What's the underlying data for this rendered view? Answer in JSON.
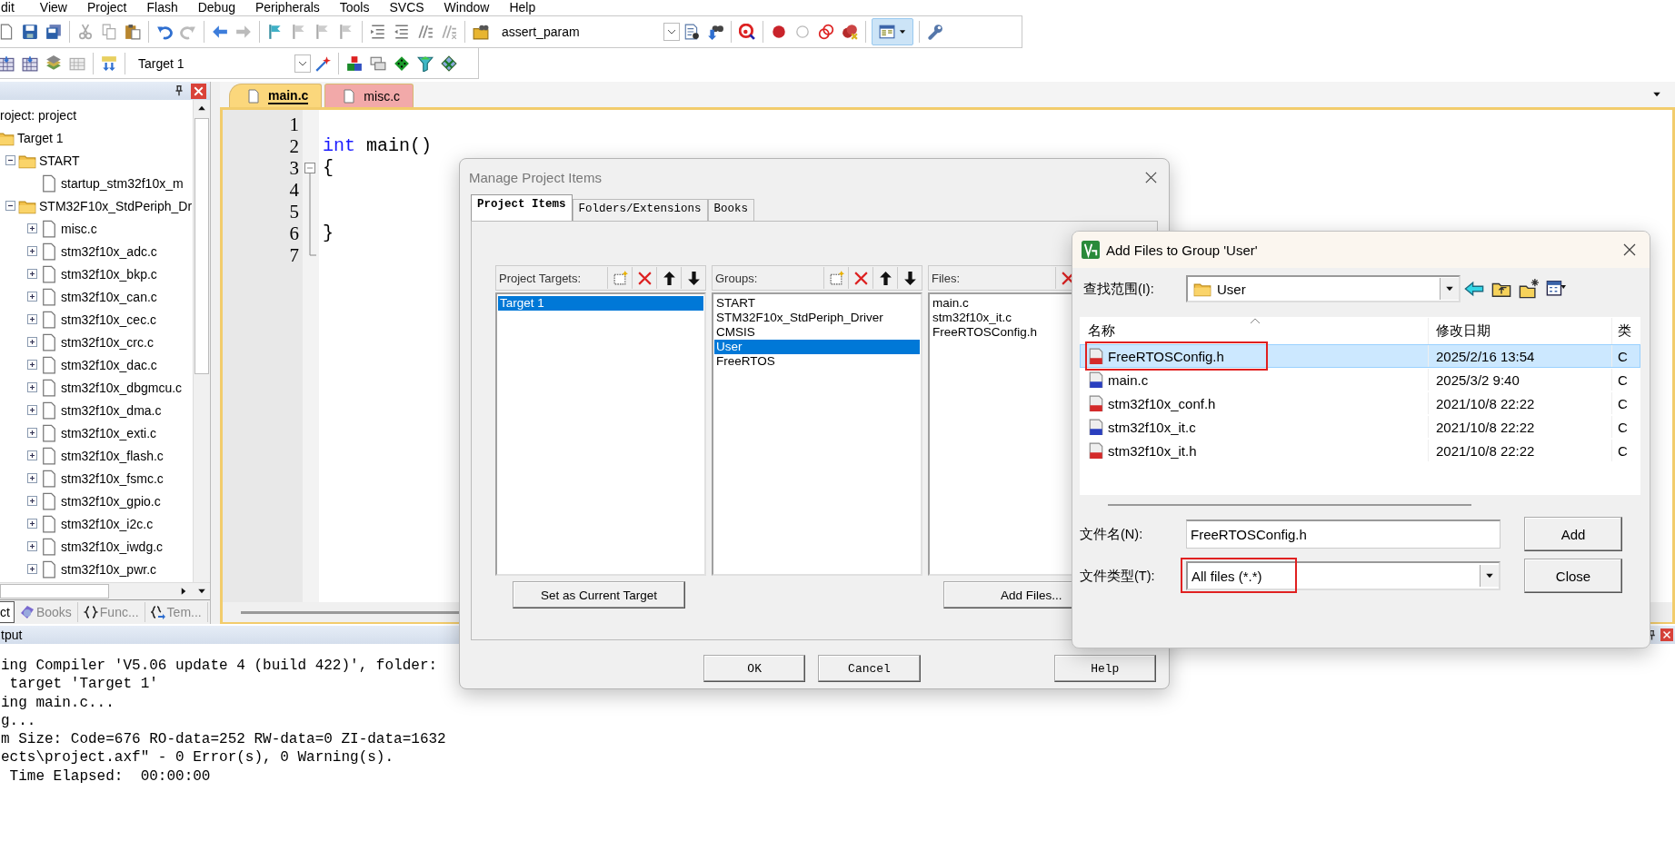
{
  "menu_bar": [
    {
      "label": "dit"
    },
    {
      "label": "View"
    },
    {
      "label": "Project"
    },
    {
      "label": "Flash"
    },
    {
      "label": "Debug"
    },
    {
      "label": "Peripherals"
    },
    {
      "label": "Tools"
    },
    {
      "label": "SVCS"
    },
    {
      "label": "Window"
    },
    {
      "label": "Help"
    }
  ],
  "toolbar": {
    "find_combo": "assert_param",
    "target_combo": "Target 1"
  },
  "project_panel": {
    "tree": [
      {
        "label": "roject: project",
        "kind": "project",
        "children": [
          {
            "label": "Target 1",
            "kind": "folder",
            "children": [
              {
                "label": "START",
                "kind": "folder",
                "expanded": true,
                "children": [
                  {
                    "label": "startup_stm32f10x_m",
                    "kind": "file"
                  }
                ]
              },
              {
                "label": "STM32F10x_StdPeriph_Dr",
                "kind": "folder",
                "expanded": true,
                "children": [
                  {
                    "label": "misc.c",
                    "kind": "file",
                    "expanded": false
                  },
                  {
                    "label": "stm32f10x_adc.c",
                    "kind": "file",
                    "expanded": false
                  },
                  {
                    "label": "stm32f10x_bkp.c",
                    "kind": "file",
                    "expanded": false
                  },
                  {
                    "label": "stm32f10x_can.c",
                    "kind": "file",
                    "expanded": false
                  },
                  {
                    "label": "stm32f10x_cec.c",
                    "kind": "file",
                    "expanded": false
                  },
                  {
                    "label": "stm32f10x_crc.c",
                    "kind": "file",
                    "expanded": false
                  },
                  {
                    "label": "stm32f10x_dac.c",
                    "kind": "file",
                    "expanded": false
                  },
                  {
                    "label": "stm32f10x_dbgmcu.c",
                    "kind": "file",
                    "expanded": false
                  },
                  {
                    "label": "stm32f10x_dma.c",
                    "kind": "file",
                    "expanded": false
                  },
                  {
                    "label": "stm32f10x_exti.c",
                    "kind": "file",
                    "expanded": false
                  },
                  {
                    "label": "stm32f10x_flash.c",
                    "kind": "file",
                    "expanded": false
                  },
                  {
                    "label": "stm32f10x_fsmc.c",
                    "kind": "file",
                    "expanded": false
                  },
                  {
                    "label": "stm32f10x_gpio.c",
                    "kind": "file",
                    "expanded": false
                  },
                  {
                    "label": "stm32f10x_i2c.c",
                    "kind": "file",
                    "expanded": false
                  },
                  {
                    "label": "stm32f10x_iwdg.c",
                    "kind": "file",
                    "expanded": false
                  },
                  {
                    "label": "stm32f10x_pwr.c",
                    "kind": "file",
                    "expanded": false
                  }
                ]
              }
            ]
          }
        ]
      }
    ],
    "tabs": [
      {
        "label": "ct",
        "kind": "project",
        "selected": true
      },
      {
        "label": "Books",
        "kind": "books",
        "selected": false
      },
      {
        "label": "Func...",
        "kind": "functions",
        "selected": false
      },
      {
        "label": "Tem...",
        "kind": "templates",
        "selected": false
      }
    ]
  },
  "editor": {
    "tabs": [
      {
        "label": "main.c",
        "selected": true,
        "color": "#fbd77c"
      },
      {
        "label": "misc.c",
        "selected": false,
        "color": "#f2a9a9"
      }
    ],
    "lines": [
      {
        "number": "1",
        "kind": "plain"
      },
      {
        "number": "2",
        "kind": "plain",
        "tokens": [
          {
            "text": "int",
            "kind": "keyword"
          },
          {
            "text": " main()",
            "kind": "plain"
          }
        ]
      },
      {
        "number": "3",
        "kind": "open",
        "tokens": [
          {
            "text": "{",
            "kind": "plain"
          }
        ]
      },
      {
        "number": "4",
        "kind": "body"
      },
      {
        "number": "5",
        "kind": "body"
      },
      {
        "number": "6",
        "kind": "body",
        "tokens": [
          {
            "text": "}",
            "kind": "plain"
          }
        ]
      },
      {
        "number": "7",
        "kind": "end"
      }
    ]
  },
  "output": {
    "title": "tput",
    "lines": [
      "ing Compiler 'V5.06 update 4 (build 422)', folder:",
      " target 'Target 1'",
      "ing main.c...",
      "g...",
      "m Size: Code=676 RO-data=252 RW-data=0 ZI-data=1632",
      "ects\\project.axf\" - 0 Error(s), 0 Warning(s).",
      " Time Elapsed:  00:00:00"
    ]
  },
  "manage_dialog": {
    "title": "Manage Project Items",
    "tabs": [
      {
        "label": "Project Items",
        "selected": true
      },
      {
        "label": "Folders/Extensions",
        "selected": false
      },
      {
        "label": "Books",
        "selected": false
      }
    ],
    "targets": {
      "label": "Project Targets:",
      "items": [
        {
          "label": "Target 1",
          "selected": true
        }
      ]
    },
    "groups": {
      "label": "Groups:",
      "items": [
        {
          "label": "START",
          "selected": false
        },
        {
          "label": "STM32F10x_StdPeriph_Driver",
          "selected": false
        },
        {
          "label": "CMSIS",
          "selected": false
        },
        {
          "label": "User",
          "selected": true
        },
        {
          "label": "FreeRTOS",
          "selected": false
        }
      ]
    },
    "files": {
      "label": "Files:",
      "items": [
        "main.c",
        "stm32f10x_it.c",
        "FreeRTOSConfig.h"
      ]
    },
    "set_target_button": "Set as Current Target",
    "add_files_button": "Add Files...",
    "buttons": [
      "OK",
      "Cancel",
      "Help"
    ]
  },
  "add_files_dialog": {
    "title": "Add Files to Group 'User'",
    "look_in_label": "查找范围(I):",
    "look_in": "User",
    "columns": [
      "名称",
      "修改日期",
      "类"
    ],
    "rows": [
      {
        "name": "FreeRTOSConfig.h",
        "date": "2025/2/16 13:54",
        "type": "C",
        "kind": "header",
        "selected": true,
        "annotated": true
      },
      {
        "name": "main.c",
        "date": "2025/3/2 9:40",
        "type": "C",
        "kind": "source",
        "selected": false,
        "annotated": false
      },
      {
        "name": "stm32f10x_conf.h",
        "date": "2021/10/8 22:22",
        "type": "C",
        "kind": "header",
        "selected": false,
        "annotated": false
      },
      {
        "name": "stm32f10x_it.c",
        "date": "2021/10/8 22:22",
        "type": "C",
        "kind": "source",
        "selected": false,
        "annotated": false
      },
      {
        "name": "stm32f10x_it.h",
        "date": "2021/10/8 22:22",
        "type": "C",
        "kind": "header",
        "selected": false,
        "annotated": false
      }
    ],
    "file_name_label": "文件名(N):",
    "file_name": "FreeRTOSConfig.h",
    "file_type_label": "文件类型(T):",
    "file_type": "All files (*.*)",
    "file_type_annotated": true,
    "buttons": [
      "Add",
      "Close"
    ]
  }
}
